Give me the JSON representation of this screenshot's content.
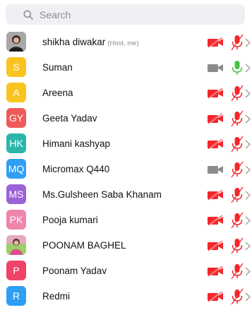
{
  "search": {
    "placeholder": "Search"
  },
  "colors": {
    "muted": "#f4262a",
    "active_mic": "#44c43c",
    "camera_off_gray": "#8c8c8c",
    "search_bg": "#f0f0f4"
  },
  "participants": [
    {
      "name": "shikha diwakar",
      "tag": "(Host, me)",
      "initials": "",
      "avatar_type": "photo",
      "avatar_color": "#8a8a8a",
      "camera": "off-red",
      "mic": "muted"
    },
    {
      "name": "Suman",
      "tag": "",
      "initials": "S",
      "avatar_type": "initials",
      "avatar_color": "#f9c41f",
      "camera": "off-gray",
      "mic": "on"
    },
    {
      "name": "Areena",
      "tag": "",
      "initials": "A",
      "avatar_type": "initials",
      "avatar_color": "#f9c41f",
      "camera": "off-red",
      "mic": "muted"
    },
    {
      "name": "Geeta Yadav",
      "tag": "",
      "initials": "GY",
      "avatar_type": "initials",
      "avatar_color": "#ef5a58",
      "camera": "off-red",
      "mic": "muted"
    },
    {
      "name": "Himani kashyap",
      "tag": "",
      "initials": "HK",
      "avatar_type": "initials",
      "avatar_color": "#2ab7aa",
      "camera": "off-red",
      "mic": "muted"
    },
    {
      "name": "Micromax Q440",
      "tag": "",
      "initials": "MQ",
      "avatar_type": "initials",
      "avatar_color": "#2f9ff3",
      "camera": "off-gray",
      "mic": "muted"
    },
    {
      "name": "Ms.Gulsheen Saba Khanam",
      "tag": "",
      "initials": "MS",
      "avatar_type": "initials",
      "avatar_color": "#9c63d6",
      "camera": "off-red",
      "mic": "muted"
    },
    {
      "name": "Pooja kumari",
      "tag": "",
      "initials": "PK",
      "avatar_type": "initials",
      "avatar_color": "#ef84ad",
      "camera": "off-red",
      "mic": "muted"
    },
    {
      "name": "POONAM BAGHEL",
      "tag": "",
      "initials": "",
      "avatar_type": "photo",
      "avatar_color": "#e8a8c0",
      "camera": "off-red",
      "mic": "muted"
    },
    {
      "name": "Poonam Yadav",
      "tag": "",
      "initials": "P",
      "avatar_type": "initials",
      "avatar_color": "#f0436a",
      "camera": "off-red",
      "mic": "muted"
    },
    {
      "name": "Redmi",
      "tag": "",
      "initials": "R",
      "avatar_type": "initials",
      "avatar_color": "#2f9ff3",
      "camera": "off-red",
      "mic": "muted"
    }
  ]
}
